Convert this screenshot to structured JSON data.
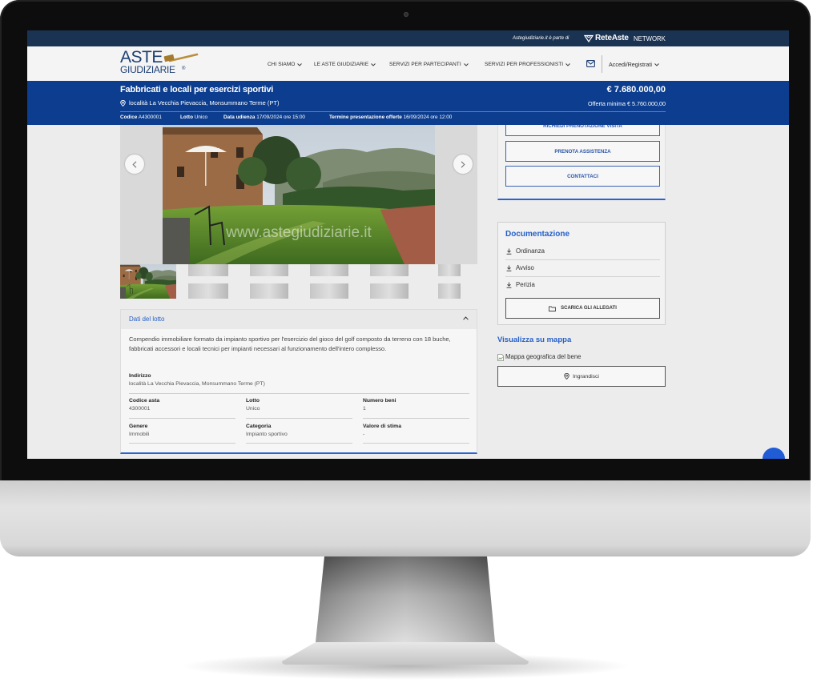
{
  "topbar": {
    "tagline": "Astegiudiziarie.it è parte di",
    "network_brand": "ReteAste",
    "network_label": "NETWORK"
  },
  "header": {
    "logo_line1": "ASTE",
    "logo_line2": "GIUDIZIARIE",
    "logo_mark": "®",
    "nav": [
      {
        "label": "CHI SIAMO"
      },
      {
        "label": "LE ASTE GIUDIZIARIE"
      },
      {
        "label": "SERVIZI PER PARTECIPANTI"
      },
      {
        "label": "SERVIZI PER PROFESSIONISTI"
      }
    ],
    "mail_icon": "mail-icon",
    "login_label": "Accedi/Registrati"
  },
  "listing": {
    "title": "Fabbricati e locali per esercizi sportivi",
    "price": "€ 7.680.000,00",
    "location": "località La Vecchia Pievaccia, Monsummano Terme (PT)",
    "min_offer_label": "Offerta minima",
    "min_offer_value": "€ 5.760.000,00",
    "meta": [
      {
        "label": "Codice",
        "value": "A4300001"
      },
      {
        "label": "Lotto",
        "value": "Unico"
      },
      {
        "label": "Data udienza",
        "value": "17/09/2024 ore 15:00"
      },
      {
        "label": "Termine presentazione offerte",
        "value": "16/09/2024 ore 12:00"
      }
    ]
  },
  "gallery": {
    "watermark": "www.astegiudiziarie.it",
    "prev_icon": "chevron-left-icon",
    "next_icon": "chevron-right-icon"
  },
  "lot_details": {
    "heading": "Dati del lotto",
    "description": "Compendio immobiliare formato da impianto sportivo per l'esercizio del gioco del golf composto da terreno con 18 buche, fabbricati accessori e locali tecnici per impianti necessari al funzionamento dell'intero complesso.",
    "address_label": "Indirizzo",
    "address_value": "località La Vecchia Pievaccia, Monsummano Terme (PT)",
    "fields": [
      {
        "label": "Codice asta",
        "value": "4300001"
      },
      {
        "label": "Lotto",
        "value": "Unico"
      },
      {
        "label": "Numero beni",
        "value": "1"
      },
      {
        "label": "Genere",
        "value": "Immobili"
      },
      {
        "label": "Categoria",
        "value": "Impianto sportivo"
      },
      {
        "label": "Valore di stima",
        "value": "-"
      }
    ]
  },
  "actions": {
    "buttons": [
      "RICHIEDI PRENOTAZIONE VISITA",
      "PRENOTA ASSISTENZA",
      "CONTATTACI"
    ]
  },
  "documents": {
    "heading": "Documentazione",
    "items": [
      "Ordinanza",
      "Avviso",
      "Perizia"
    ],
    "download_all": "SCARICA GLI ALLEGATI"
  },
  "map": {
    "heading": "Visualizza su mappa",
    "image_alt": "Mappa geografica del bene",
    "enlarge": "Ingrandisci"
  },
  "colors": {
    "topbar_navy": "#1b3353",
    "band_blue": "#0c3d8e",
    "accent_blue": "#2560c8",
    "logo_navy": "#1d3f73",
    "gavel_gold": "#b98f3d"
  }
}
